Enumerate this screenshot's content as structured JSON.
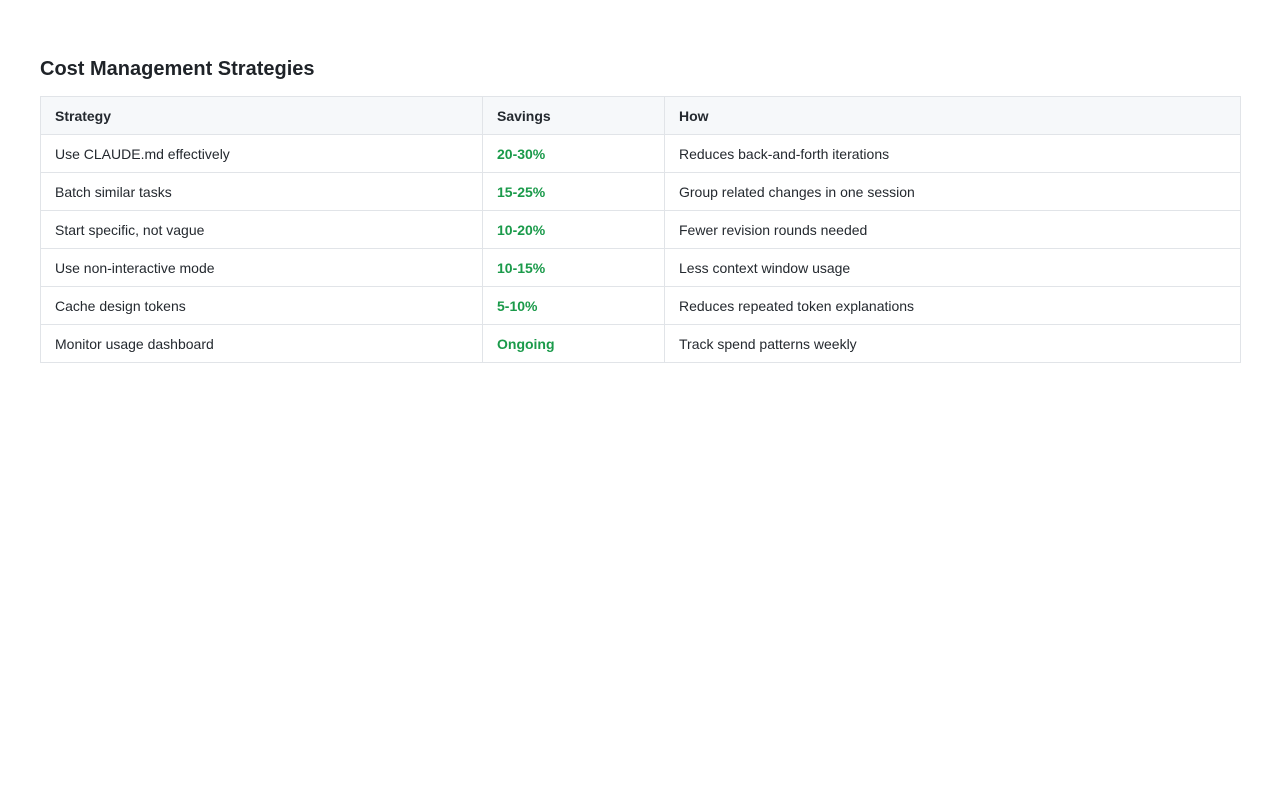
{
  "page": {
    "title": "Cost Management Strategies"
  },
  "table": {
    "headers": {
      "strategy": "Strategy",
      "savings": "Savings",
      "how": "How"
    },
    "rows": [
      {
        "strategy": "Use CLAUDE.md effectively",
        "savings": "20-30%",
        "how": "Reduces back-and-forth iterations"
      },
      {
        "strategy": "Batch similar tasks",
        "savings": "15-25%",
        "how": "Group related changes in one session"
      },
      {
        "strategy": "Start specific, not vague",
        "savings": "10-20%",
        "how": "Fewer revision rounds needed"
      },
      {
        "strategy": "Use non-interactive mode",
        "savings": "10-15%",
        "how": "Less context window usage"
      },
      {
        "strategy": "Cache design tokens",
        "savings": "5-10%",
        "how": "Reduces repeated token explanations"
      },
      {
        "strategy": "Monitor usage dashboard",
        "savings": "Ongoing",
        "how": "Track spend patterns weekly"
      }
    ]
  },
  "colors": {
    "savings_text": "#1a9a4a",
    "header_bg": "#f6f8fa",
    "border": "#e1e4e8"
  }
}
